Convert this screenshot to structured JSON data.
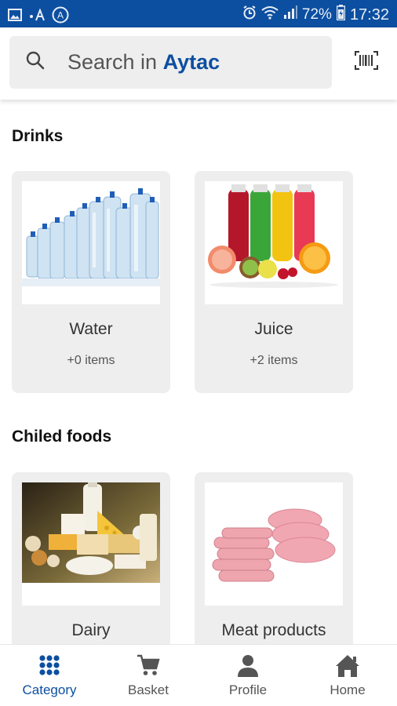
{
  "status_bar": {
    "battery_percent": "72%",
    "time": "17:32",
    "badge_letter": "A",
    "icons": [
      "image-icon",
      "font-size-icon",
      "a-circle-icon",
      "alarm-icon",
      "wifi-icon",
      "signal-icon",
      "battery-icon"
    ]
  },
  "header": {
    "search_prefix": "Search in ",
    "search_brand": "Aytac",
    "search_icon": "search-icon",
    "barcode_icon": "barcode-icon"
  },
  "sections": [
    {
      "title": "Drinks",
      "categories": [
        {
          "name": "Water",
          "count": "+0 items",
          "image": "water-bottles-image"
        },
        {
          "name": "Juice",
          "count": "+2 items",
          "image": "juice-bottles-image"
        }
      ]
    },
    {
      "title": "Chiled foods",
      "categories": [
        {
          "name": "Dairy",
          "count": "",
          "image": "dairy-image"
        },
        {
          "name": "Meat products",
          "count": "",
          "image": "meat-products-image"
        }
      ]
    }
  ],
  "bottom_nav": {
    "active_color": "#0c4fa0",
    "items": [
      {
        "label": "Category",
        "icon": "grid-icon",
        "active": true
      },
      {
        "label": "Basket",
        "icon": "cart-icon",
        "active": false
      },
      {
        "label": "Profile",
        "icon": "user-icon",
        "active": false
      },
      {
        "label": "Home",
        "icon": "home-icon",
        "active": false
      }
    ]
  },
  "colors": {
    "brand": "#0c4fa0",
    "card_background": "#eeeeee",
    "search_background": "#eeeeee"
  }
}
